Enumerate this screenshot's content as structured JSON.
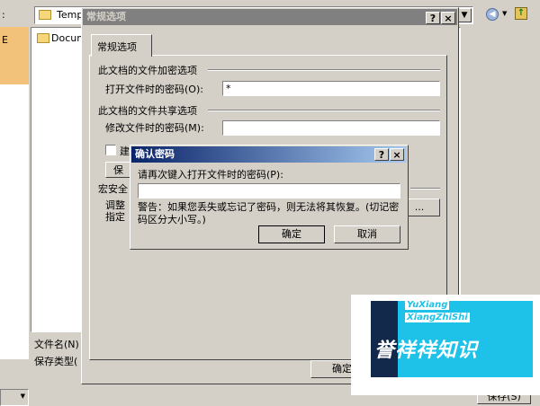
{
  "background_dialog": {
    "left_label_top": ":",
    "left_side_char": "E",
    "folder_path": "Temp",
    "list_item": "Docum",
    "filename_label": "文件名(N)",
    "filetype_label": "保存类型(",
    "save_button": "保存(S)",
    "ok_button": "确定"
  },
  "options_dialog": {
    "title": "常规选项",
    "tab_label": "常规选项",
    "group1_label": "此文档的文件加密选项",
    "open_password_label": "打开文件时的密码(O):",
    "open_password_value": "*",
    "group2_label": "此文档的文件共享选项",
    "modify_password_label": "修改文件时的密码(M):",
    "modify_password_value": "",
    "checkbox_label_partial": "建",
    "protect_button_partial": "保",
    "macro_group_label": "宏安全",
    "macro_text_line1": "调整",
    "macro_text_line2": "指定",
    "macro_button": "..."
  },
  "confirm_dialog": {
    "title": "确认密码",
    "prompt": "请再次键入打开文件时的密码(P):",
    "value": "",
    "warning": "警告：如果您丢失或忘记了密码，则无法将其恢复。(切记密码区分大小写。)",
    "ok": "确定",
    "cancel": "取消"
  },
  "titlebar_buttons": {
    "help": "?",
    "close": "×"
  },
  "watermark": {
    "en_line1": "YuXiang",
    "en_line2": "XiangZhiShi",
    "zh": "誉祥祥知识"
  },
  "colors": {
    "titlebar_active_start": "#0a246a",
    "titlebar_active_end": "#a6caf0",
    "titlebar_inactive": "#808080",
    "face": "#d4d0c8",
    "watermark_cyan": "#1ec2e8",
    "watermark_navy": "#13294b"
  }
}
